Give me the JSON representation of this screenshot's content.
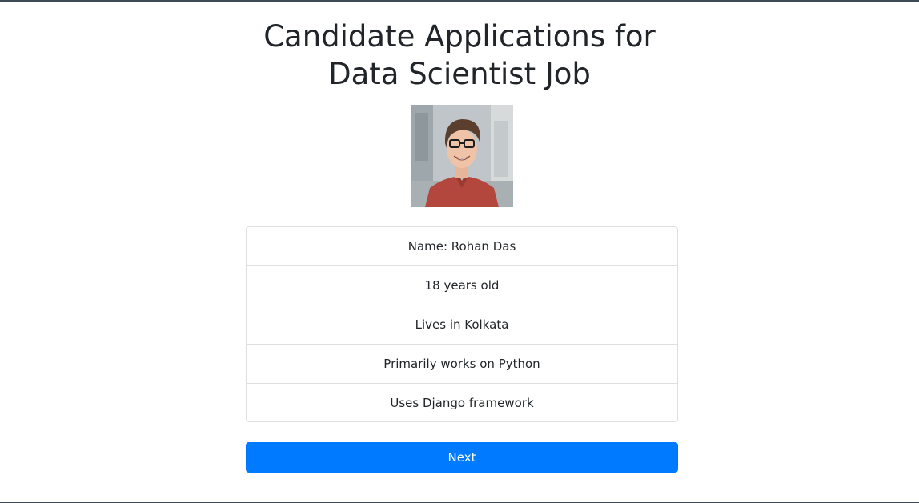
{
  "page": {
    "title_line1": "Candidate Applications for",
    "title_line2": "Data Scientist Job"
  },
  "candidate": {
    "photo_alt": "Candidate photo",
    "details": [
      "Name: Rohan Das",
      "18 years old",
      "Lives in Kolkata",
      "Primarily works on Python",
      "Uses Django framework"
    ]
  },
  "actions": {
    "next_label": "Next"
  },
  "colors": {
    "primary": "#007bff",
    "text": "#212529",
    "frame_border": "#3e4a55"
  }
}
